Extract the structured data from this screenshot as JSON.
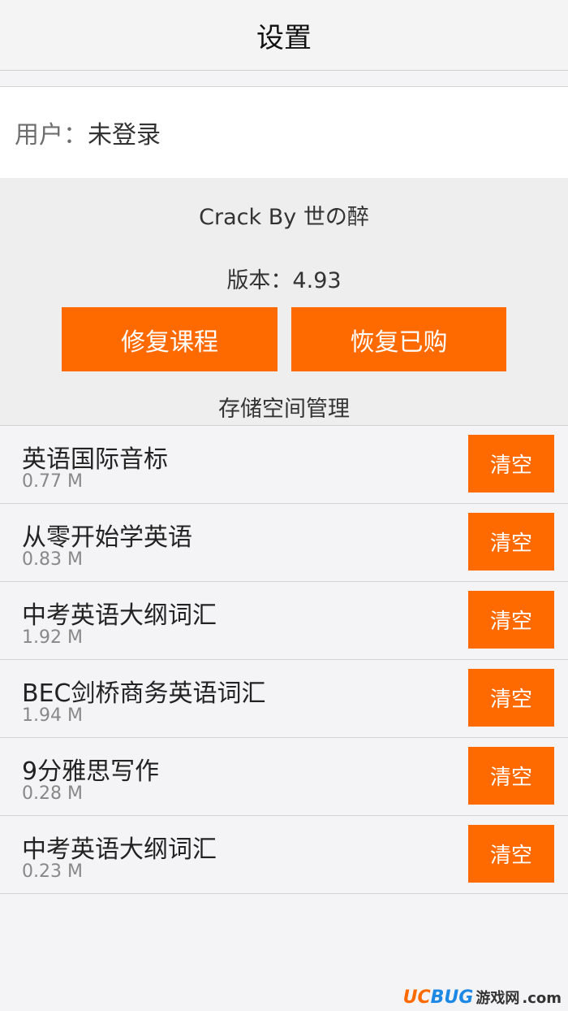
{
  "header": {
    "title": "设置"
  },
  "user": {
    "label": "用户：",
    "value": "未登录"
  },
  "info": {
    "credit": "Crack By 世の醉",
    "version": "版本：4.93",
    "repair_label": "修复课程",
    "restore_label": "恢复已购",
    "storage_title": "存储空间管理"
  },
  "storage": {
    "clear_label": "清空",
    "items": [
      {
        "name": "英语国际音标",
        "size": "0.77 M"
      },
      {
        "name": "从零开始学英语",
        "size": "0.83 M"
      },
      {
        "name": "中考英语大纲词汇",
        "size": "1.92 M"
      },
      {
        "name": "BEC剑桥商务英语词汇",
        "size": "1.94 M"
      },
      {
        "name": "9分雅思写作",
        "size": "0.28 M"
      },
      {
        "name": "中考英语大纲词汇",
        "size": "0.23 M"
      }
    ]
  },
  "watermark": {
    "brand_a": "UC",
    "brand_b": "BUG",
    "text": "游戏网",
    "domain": ".com"
  },
  "colors": {
    "accent": "#ff6a00",
    "background": "#f4f4f6"
  }
}
